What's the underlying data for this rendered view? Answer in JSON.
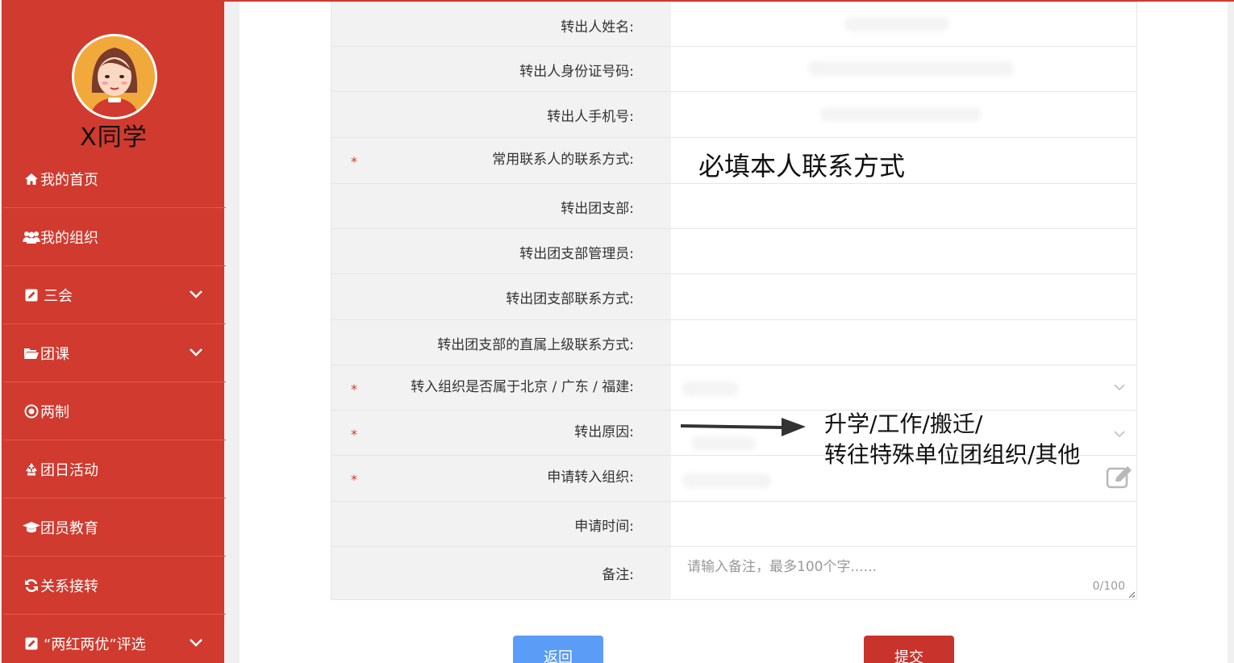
{
  "user": {
    "name": "X同学"
  },
  "sidebar": {
    "items": [
      {
        "label": "我的首页",
        "icon": "home-icon",
        "has_chevron": false
      },
      {
        "label": "我的组织",
        "icon": "users-icon",
        "has_chevron": false
      },
      {
        "label": "三会",
        "icon": "edit-icon",
        "has_chevron": true
      },
      {
        "label": "团课",
        "icon": "folder-icon",
        "has_chevron": true
      },
      {
        "label": "两制",
        "icon": "target-icon",
        "has_chevron": false
      },
      {
        "label": "团日活动",
        "icon": "recycle-icon",
        "has_chevron": false
      },
      {
        "label": "团员教育",
        "icon": "graduation-cap-icon",
        "has_chevron": false
      },
      {
        "label": "关系接转",
        "icon": "refresh-icon",
        "has_chevron": false
      },
      {
        "label": "“两红两优”评选",
        "icon": "edit-icon",
        "has_chevron": true
      }
    ]
  },
  "form": {
    "rows": [
      {
        "label": "转出人姓名:",
        "required": false
      },
      {
        "label": "转出人身份证号码:",
        "required": false
      },
      {
        "label": "转出人手机号:",
        "required": false
      },
      {
        "label": "常用联系人的联系方式:",
        "required": true
      },
      {
        "label": "转出团支部:",
        "required": false
      },
      {
        "label": "转出团支部管理员:",
        "required": false
      },
      {
        "label": "转出团支部联系方式:",
        "required": false
      },
      {
        "label": "转出团支部的直属上级联系方式:",
        "required": false
      },
      {
        "label": "转入组织是否属于北京 / 广东 / 福建:",
        "required": true
      },
      {
        "label": "转出原因:",
        "required": true
      },
      {
        "label": "申请转入组织:",
        "required": true
      },
      {
        "label": "申请时间:",
        "required": false
      },
      {
        "label": "备注:",
        "required": false
      }
    ],
    "required_mark": "*",
    "remark_placeholder": "请输入备注，最多100个字......",
    "remark_counter": "0/100"
  },
  "annotations": {
    "contact_note": "必填本人联系方式",
    "reason_line1": "升学/工作/搬迁/",
    "reason_line2": "转往特殊单位团组织/其他"
  },
  "buttons": {
    "back": "返回",
    "submit": "提交"
  },
  "colors": {
    "primary_red": "#d13a2e",
    "back_blue": "#5b9cf6",
    "submit_red": "#c8342c"
  }
}
